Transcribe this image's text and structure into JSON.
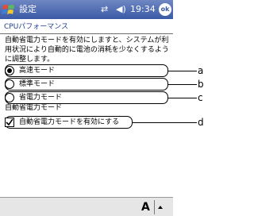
{
  "titlebar": {
    "app_title": "設定",
    "time": "19:34",
    "ok_label": "ok",
    "start_icon": "windows-flag-icon",
    "connectivity_icon": "connectivity-arrows-icon",
    "volume_icon": "speaker-icon",
    "bar_color": "#3a59a6"
  },
  "page": {
    "title": "CPUパフォーマンス",
    "description": "自動省電力モードを有効にしますと、システムが利用状況により自動的に電池の消耗を少なくするように調整します。"
  },
  "modes": {
    "options": [
      {
        "label": "高速モード",
        "selected": true,
        "callout": "a"
      },
      {
        "label": "標準モード",
        "selected": false,
        "callout": "b"
      },
      {
        "label": "省電力モード",
        "selected": false,
        "callout": "c"
      }
    ]
  },
  "auto_power": {
    "section_label": "自動省電力モード",
    "checkbox_label": "自動省電力モードを有効にする",
    "checked": true,
    "callout": "d"
  },
  "bottombar": {
    "sip_label": "A",
    "sip_icon": "keyboard-input-icon"
  }
}
